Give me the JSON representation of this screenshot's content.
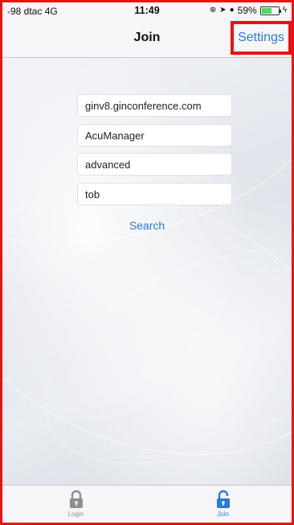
{
  "status_bar": {
    "carrier": "-98 dtac  4G",
    "time": "11:49",
    "battery_percent": "59%",
    "battery_level": 0.59,
    "icons": [
      "orientation-lock-icon",
      "location-arrow-icon",
      "alarm-icon",
      "battery-icon",
      "charging-icon"
    ]
  },
  "nav": {
    "title": "Join",
    "settings_label": "Settings"
  },
  "form": {
    "server": "ginv8.ginconference.com",
    "application": "AcuManager",
    "mode": "advanced",
    "user": "tob",
    "search_label": "Search"
  },
  "tabs": [
    {
      "label": "Login",
      "icon": "lock-icon",
      "active": false
    },
    {
      "label": "Join",
      "icon": "unlock-icon",
      "active": true
    }
  ],
  "colors": {
    "accent": "#2b7ad9",
    "highlight_border": "#ee1111",
    "inactive": "#8e8e93"
  }
}
